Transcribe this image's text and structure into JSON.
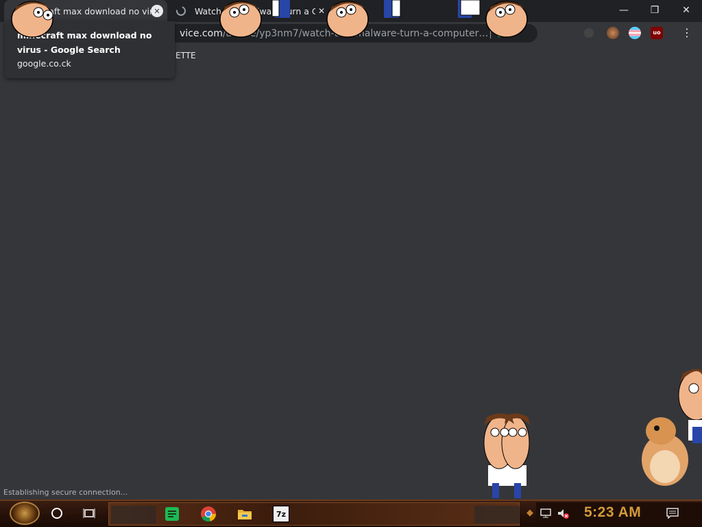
{
  "browser": {
    "tabs": [
      {
        "title": "minecraft max download no virus",
        "active": true
      },
      {
        "title": "Watch This Malware Turn a Computer Com",
        "active": false
      }
    ],
    "window_controls": {
      "minimize": "—",
      "restore": "❐",
      "close": "✕"
    },
    "omnibox": {
      "host": "vice.com",
      "path": "/article/yp3nm7/watch-this-malware-turn-a-computer…"
    },
    "menu_glyph": "⋮"
  },
  "omnibox_dropdown": {
    "suggestion_title": "minecraft max download no virus - Google Search",
    "suggestion_url": "google.co.ck"
  },
  "page": {
    "fragment_text": "ETTE",
    "status_text": "Establishing secure connection..."
  },
  "taskbar": {
    "clock": "5:23 AM",
    "apps": [
      "chrome-icon",
      "file-explorer-icon",
      "7zip-icon"
    ],
    "seven_zip_label": "7z"
  },
  "colors": {
    "tabstrip": "#202124",
    "page_bg": "#35363a",
    "clock_orange": "#d49a3a",
    "taskbar_brown": "#3a1d12"
  }
}
